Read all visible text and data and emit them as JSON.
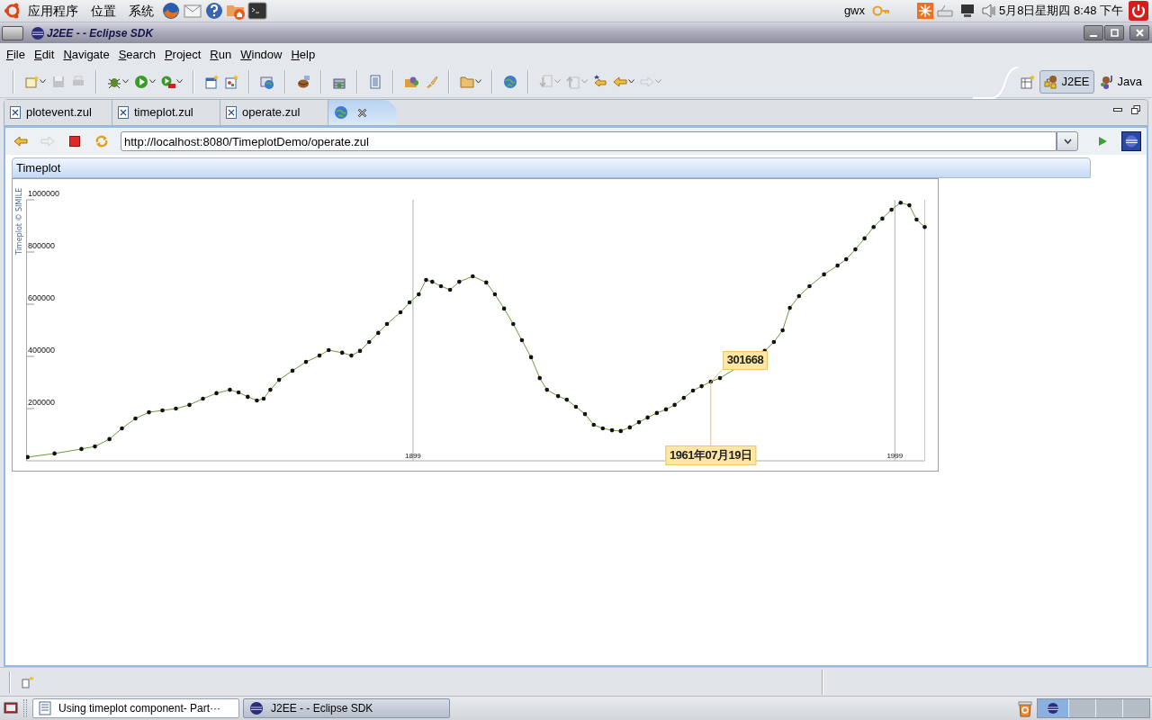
{
  "top_panel": {
    "menus": [
      "应用程序",
      "位置",
      "系统"
    ],
    "user": "gwx",
    "clock": "5月8日星期四 8:48 下午"
  },
  "window": {
    "title": "J2EE - - Eclipse SDK"
  },
  "menu": [
    "File",
    "Edit",
    "Navigate",
    "Search",
    "Project",
    "Run",
    "Window",
    "Help"
  ],
  "toolbar": [
    [
      {
        "dropdown": true,
        "disabled": false
      },
      {
        "dropdown": false,
        "disabled": true
      },
      {
        "dropdown": false,
        "disabled": true
      }
    ],
    [
      {
        "dropdown": true,
        "disabled": false
      },
      {
        "dropdown": true,
        "disabled": false
      },
      {
        "dropdown": true,
        "disabled": false
      }
    ],
    [
      {
        "dropdown": false,
        "disabled": false
      },
      {
        "dropdown": false,
        "disabled": false
      }
    ],
    [
      {
        "dropdown": false,
        "disabled": false
      }
    ],
    [
      {
        "dropdown": false,
        "disabled": false
      }
    ],
    [
      {
        "dropdown": false,
        "disabled": false
      }
    ],
    [
      {
        "dropdown": false,
        "disabled": false
      }
    ],
    [
      {
        "dropdown": false,
        "disabled": false
      },
      {
        "dropdown": false,
        "disabled": false
      }
    ],
    [
      {
        "dropdown": true,
        "disabled": false
      }
    ],
    [
      {
        "dropdown": false,
        "disabled": false
      }
    ],
    [
      {
        "dropdown": true,
        "disabled": true
      },
      {
        "dropdown": true,
        "disabled": true
      },
      {
        "dropdown": false,
        "disabled": false
      },
      {
        "dropdown": true,
        "disabled": false
      },
      {
        "dropdown": true,
        "disabled": true
      }
    ]
  ],
  "perspectives": [
    {
      "label": "J2EE",
      "selected": true
    },
    {
      "label": "Java",
      "selected": false
    }
  ],
  "editor_tabs": [
    {
      "kind": "file",
      "label": "plotevent.zul",
      "selected": false
    },
    {
      "kind": "file",
      "label": "timeplot.zul",
      "selected": false
    },
    {
      "kind": "file",
      "label": "operate.zul",
      "selected": false
    },
    {
      "kind": "browser",
      "selected": true
    }
  ],
  "browser": {
    "url": "http://localhost:8080/TimeplotDemo/operate.zul",
    "back_disabled": false,
    "forward_disabled": true
  },
  "page": {
    "panel_title": "Timeplot",
    "credit": "Timeplot © SIMILE",
    "chart_data": {
      "type": "line",
      "x": [
        1819,
        1824.6,
        1830.2,
        1833,
        1836,
        1838.6,
        1841.4,
        1844.2,
        1847,
        1849.8,
        1852.6,
        1855.4,
        1858.2,
        1861,
        1862.8,
        1864.7,
        1866.6,
        1868,
        1869.4,
        1871.2,
        1874,
        1876.8,
        1879.6,
        1881.5,
        1884.3,
        1886.2,
        1888,
        1889.9,
        1891.8,
        1893.6,
        1896.4,
        1898.3,
        1900.2,
        1901.7,
        1903,
        1904.8,
        1906.7,
        1908.6,
        1911.4,
        1914.2,
        1916,
        1917.9,
        1919.8,
        1921.6,
        1923.5,
        1925.3,
        1926.8,
        1929.1,
        1930.9,
        1932.8,
        1934.7,
        1936.5,
        1938.4,
        1940.3,
        1942.1,
        1944,
        1945.9,
        1947.7,
        1949.6,
        1951.5,
        1953.3,
        1955.2,
        1957.1,
        1958.9,
        1960.8,
        1962.7,
        1972,
        1973.9,
        1975.7,
        1977.2,
        1979.1,
        1981.3,
        1984.3,
        1987.1,
        1988.9,
        1990.8,
        1992.7,
        1994.6,
        1996.4,
        1998.3,
        2000.2,
        2002,
        2003.5,
        2005.2
      ],
      "series": [
        {
          "color": "#6a9a3a",
          "values": [
            14000,
            28000,
            45000,
            55000,
            83000,
            124000,
            162000,
            186000,
            193000,
            200000,
            214000,
            238000,
            259000,
            272000,
            262000,
            245000,
            231000,
            238000,
            272000,
            310000,
            345000,
            379000,
            403000,
            424000,
            414000,
            403000,
            421000,
            455000,
            490000,
            524000,
            569000,
            607000,
            638000,
            693000,
            686000,
            669000,
            655000,
            686000,
            707000,
            683000,
            638000,
            583000,
            524000,
            462000,
            397000,
            317000,
            272000,
            248000,
            234000,
            207000,
            179000,
            138000,
            124000,
            117000,
            114000,
            128000,
            148000,
            166000,
            183000,
            197000,
            214000,
            241000,
            269000,
            286000,
            303000,
            317000,
            421000,
            455000,
            500000,
            586000,
            631000,
            669000,
            714000,
            748000,
            772000,
            810000,
            852000,
            896000,
            928000,
            962000,
            989000,
            979000,
            924000,
            896000
          ]
        }
      ],
      "xlim": [
        1818.8,
        2005.2
      ],
      "ylim": [
        0,
        1000000
      ],
      "xticks": [
        {
          "value": 1899,
          "label": "1899"
        },
        {
          "value": 1999,
          "label": "1999"
        }
      ],
      "yticks": [
        200000,
        400000,
        600000,
        800000,
        1000000
      ],
      "annotations": [
        {
          "x": 1960.8,
          "y": 301668,
          "text": "301668"
        },
        "1961年07月19日"
      ]
    }
  },
  "taskbar": {
    "tasks": [
      {
        "label": "Using timeplot component- Part···",
        "selected": false
      },
      {
        "label": "J2EE - - Eclipse SDK",
        "selected": true
      }
    ]
  }
}
